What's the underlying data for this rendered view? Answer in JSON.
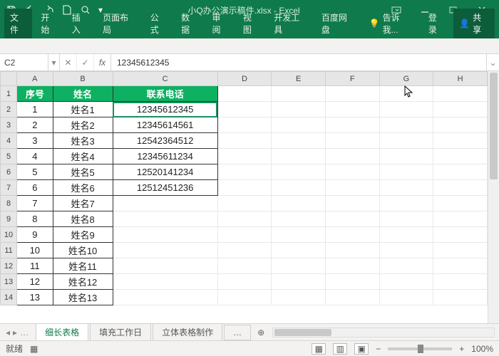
{
  "title": "小Q办公演示稿件.xlsx - Excel",
  "tabs": {
    "file": "文件",
    "home": "开始",
    "insert": "插入",
    "layout": "页面布局",
    "formula": "公式",
    "data": "数据",
    "review": "审阅",
    "view": "视图",
    "dev": "开发工具",
    "baidu": "百度网盘",
    "tell": "告诉我...",
    "login": "登录",
    "share": "共享"
  },
  "name_box": "C2",
  "formula_value": "12345612345",
  "cols": [
    "A",
    "B",
    "C",
    "D",
    "E",
    "F",
    "G",
    "H"
  ],
  "hdr": {
    "a": "序号",
    "b": "姓名",
    "c": "联系电话"
  },
  "rows": [
    {
      "n": "1",
      "name": "姓名1",
      "tel": "12345612345"
    },
    {
      "n": "2",
      "name": "姓名2",
      "tel": "12345614561"
    },
    {
      "n": "3",
      "name": "姓名3",
      "tel": "12542364512"
    },
    {
      "n": "4",
      "name": "姓名4",
      "tel": "12345611234"
    },
    {
      "n": "5",
      "name": "姓名5",
      "tel": "12520141234"
    },
    {
      "n": "6",
      "name": "姓名6",
      "tel": "12512451236"
    },
    {
      "n": "7",
      "name": "姓名7",
      "tel": ""
    },
    {
      "n": "8",
      "name": "姓名8",
      "tel": ""
    },
    {
      "n": "9",
      "name": "姓名9",
      "tel": ""
    },
    {
      "n": "10",
      "name": "姓名10",
      "tel": ""
    },
    {
      "n": "11",
      "name": "姓名11",
      "tel": ""
    },
    {
      "n": "12",
      "name": "姓名12",
      "tel": ""
    },
    {
      "n": "13",
      "name": "姓名13",
      "tel": ""
    }
  ],
  "sheets": {
    "active": "细长表格",
    "s2": "填充工作日",
    "s3": "立体表格制作"
  },
  "status": {
    "ready": "就绪",
    "zoom": "100%"
  }
}
